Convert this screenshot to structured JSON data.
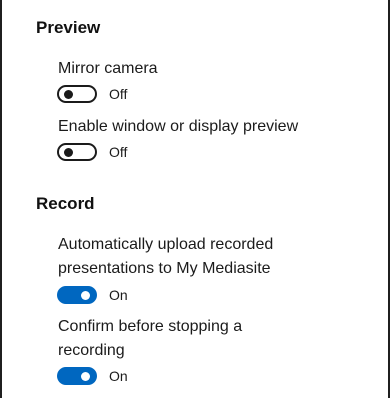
{
  "preview": {
    "title": "Preview",
    "settings": [
      {
        "label": "Mirror camera",
        "state": "Off"
      },
      {
        "label": "Enable window or display preview",
        "state": "Off"
      }
    ]
  },
  "record": {
    "title": "Record",
    "settings": [
      {
        "label_line1": "Automatically upload recorded",
        "label_line2": "presentations to My Mediasite",
        "state": "On"
      },
      {
        "label_line1": "Confirm before stopping a",
        "label_line2": "recording",
        "state": "On"
      }
    ]
  },
  "colors": {
    "toggle_on": "#0067c0",
    "toggle_off_border": "#1b1b1b"
  }
}
